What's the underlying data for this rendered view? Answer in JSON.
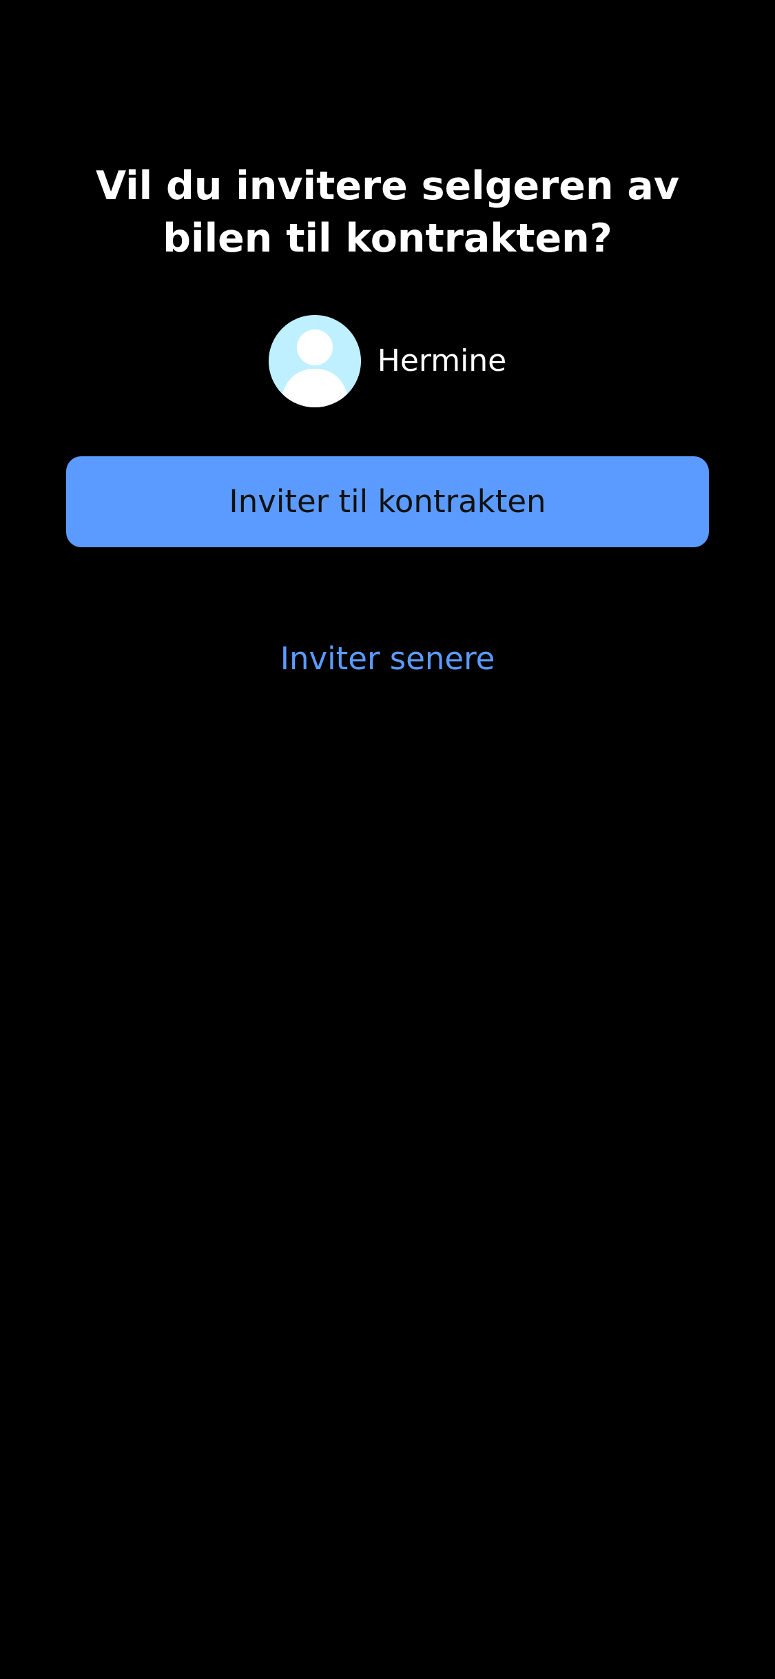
{
  "screen": {
    "title": "Vil du invitere selgeren av bilen til kontrakten?",
    "recipient": {
      "name": "Hermine",
      "avatar_icon": "person-placeholder-icon",
      "avatar_color": "#bff0ff"
    },
    "primary_button_label": "Inviter til kontrakten",
    "secondary_link_label": "Inviter senere"
  },
  "colors": {
    "background": "#000000",
    "accent": "#5b9bff",
    "text": "#ffffff",
    "button_text": "#111111"
  }
}
